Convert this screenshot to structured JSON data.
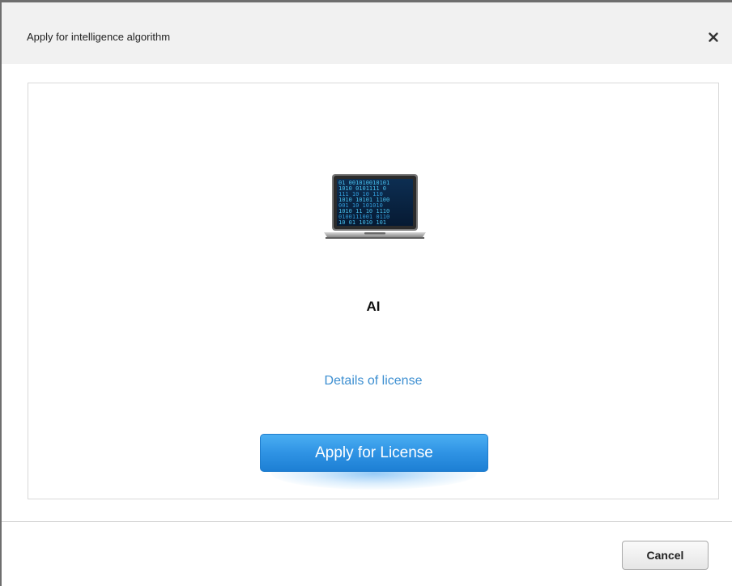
{
  "dialog": {
    "title": "Apply for intelligence algorithm",
    "close_icon": "close-icon"
  },
  "content": {
    "illustration_icon": "binary-laptop-icon",
    "module_name": "AI",
    "details_link": "Details of license",
    "apply_button": "Apply for License"
  },
  "footer": {
    "cancel_button": "Cancel"
  },
  "colors": {
    "link": "#3d8fd1",
    "primary_button": "#2f93e4",
    "header_bg": "#f1f1f1"
  }
}
